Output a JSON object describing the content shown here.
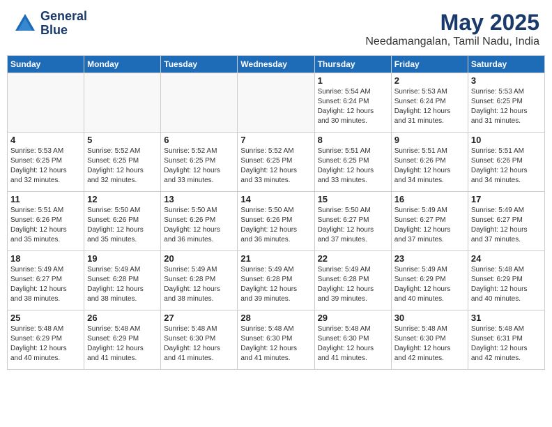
{
  "header": {
    "logo_line1": "General",
    "logo_line2": "Blue",
    "month_year": "May 2025",
    "location": "Needamangalan, Tamil Nadu, India"
  },
  "weekdays": [
    "Sunday",
    "Monday",
    "Tuesday",
    "Wednesday",
    "Thursday",
    "Friday",
    "Saturday"
  ],
  "weeks": [
    [
      {
        "day": "",
        "text": ""
      },
      {
        "day": "",
        "text": ""
      },
      {
        "day": "",
        "text": ""
      },
      {
        "day": "",
        "text": ""
      },
      {
        "day": "1",
        "text": "Sunrise: 5:54 AM\nSunset: 6:24 PM\nDaylight: 12 hours\nand 30 minutes."
      },
      {
        "day": "2",
        "text": "Sunrise: 5:53 AM\nSunset: 6:24 PM\nDaylight: 12 hours\nand 31 minutes."
      },
      {
        "day": "3",
        "text": "Sunrise: 5:53 AM\nSunset: 6:25 PM\nDaylight: 12 hours\nand 31 minutes."
      }
    ],
    [
      {
        "day": "4",
        "text": "Sunrise: 5:53 AM\nSunset: 6:25 PM\nDaylight: 12 hours\nand 32 minutes."
      },
      {
        "day": "5",
        "text": "Sunrise: 5:52 AM\nSunset: 6:25 PM\nDaylight: 12 hours\nand 32 minutes."
      },
      {
        "day": "6",
        "text": "Sunrise: 5:52 AM\nSunset: 6:25 PM\nDaylight: 12 hours\nand 33 minutes."
      },
      {
        "day": "7",
        "text": "Sunrise: 5:52 AM\nSunset: 6:25 PM\nDaylight: 12 hours\nand 33 minutes."
      },
      {
        "day": "8",
        "text": "Sunrise: 5:51 AM\nSunset: 6:25 PM\nDaylight: 12 hours\nand 33 minutes."
      },
      {
        "day": "9",
        "text": "Sunrise: 5:51 AM\nSunset: 6:26 PM\nDaylight: 12 hours\nand 34 minutes."
      },
      {
        "day": "10",
        "text": "Sunrise: 5:51 AM\nSunset: 6:26 PM\nDaylight: 12 hours\nand 34 minutes."
      }
    ],
    [
      {
        "day": "11",
        "text": "Sunrise: 5:51 AM\nSunset: 6:26 PM\nDaylight: 12 hours\nand 35 minutes."
      },
      {
        "day": "12",
        "text": "Sunrise: 5:50 AM\nSunset: 6:26 PM\nDaylight: 12 hours\nand 35 minutes."
      },
      {
        "day": "13",
        "text": "Sunrise: 5:50 AM\nSunset: 6:26 PM\nDaylight: 12 hours\nand 36 minutes."
      },
      {
        "day": "14",
        "text": "Sunrise: 5:50 AM\nSunset: 6:26 PM\nDaylight: 12 hours\nand 36 minutes."
      },
      {
        "day": "15",
        "text": "Sunrise: 5:50 AM\nSunset: 6:27 PM\nDaylight: 12 hours\nand 37 minutes."
      },
      {
        "day": "16",
        "text": "Sunrise: 5:49 AM\nSunset: 6:27 PM\nDaylight: 12 hours\nand 37 minutes."
      },
      {
        "day": "17",
        "text": "Sunrise: 5:49 AM\nSunset: 6:27 PM\nDaylight: 12 hours\nand 37 minutes."
      }
    ],
    [
      {
        "day": "18",
        "text": "Sunrise: 5:49 AM\nSunset: 6:27 PM\nDaylight: 12 hours\nand 38 minutes."
      },
      {
        "day": "19",
        "text": "Sunrise: 5:49 AM\nSunset: 6:28 PM\nDaylight: 12 hours\nand 38 minutes."
      },
      {
        "day": "20",
        "text": "Sunrise: 5:49 AM\nSunset: 6:28 PM\nDaylight: 12 hours\nand 38 minutes."
      },
      {
        "day": "21",
        "text": "Sunrise: 5:49 AM\nSunset: 6:28 PM\nDaylight: 12 hours\nand 39 minutes."
      },
      {
        "day": "22",
        "text": "Sunrise: 5:49 AM\nSunset: 6:28 PM\nDaylight: 12 hours\nand 39 minutes."
      },
      {
        "day": "23",
        "text": "Sunrise: 5:49 AM\nSunset: 6:29 PM\nDaylight: 12 hours\nand 40 minutes."
      },
      {
        "day": "24",
        "text": "Sunrise: 5:48 AM\nSunset: 6:29 PM\nDaylight: 12 hours\nand 40 minutes."
      }
    ],
    [
      {
        "day": "25",
        "text": "Sunrise: 5:48 AM\nSunset: 6:29 PM\nDaylight: 12 hours\nand 40 minutes."
      },
      {
        "day": "26",
        "text": "Sunrise: 5:48 AM\nSunset: 6:29 PM\nDaylight: 12 hours\nand 41 minutes."
      },
      {
        "day": "27",
        "text": "Sunrise: 5:48 AM\nSunset: 6:30 PM\nDaylight: 12 hours\nand 41 minutes."
      },
      {
        "day": "28",
        "text": "Sunrise: 5:48 AM\nSunset: 6:30 PM\nDaylight: 12 hours\nand 41 minutes."
      },
      {
        "day": "29",
        "text": "Sunrise: 5:48 AM\nSunset: 6:30 PM\nDaylight: 12 hours\nand 41 minutes."
      },
      {
        "day": "30",
        "text": "Sunrise: 5:48 AM\nSunset: 6:30 PM\nDaylight: 12 hours\nand 42 minutes."
      },
      {
        "day": "31",
        "text": "Sunrise: 5:48 AM\nSunset: 6:31 PM\nDaylight: 12 hours\nand 42 minutes."
      }
    ]
  ]
}
